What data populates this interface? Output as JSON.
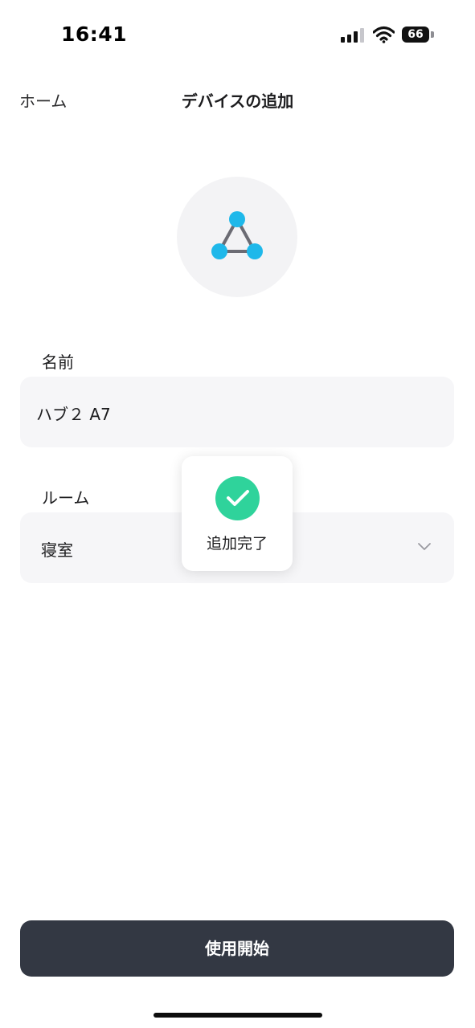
{
  "status_bar": {
    "time": "16:41",
    "battery": "66",
    "signal_icon": "cellular-signal-icon",
    "wifi_icon": "wifi-icon"
  },
  "nav": {
    "back_label": "ホーム",
    "title": "デバイスの追加"
  },
  "device": {
    "icon": "hub-triangle-icon",
    "accent_color": "#1eb8ea"
  },
  "form": {
    "name_label": "名前",
    "name_value": "ハブ２ A7",
    "room_label": "ルーム",
    "room_value": "寝室",
    "room_dropdown_icon": "chevron-down-icon"
  },
  "toast": {
    "icon": "check-circle-icon",
    "text": "追加完了",
    "color": "#2fd39b"
  },
  "primary_button": {
    "label": "使用開始"
  }
}
